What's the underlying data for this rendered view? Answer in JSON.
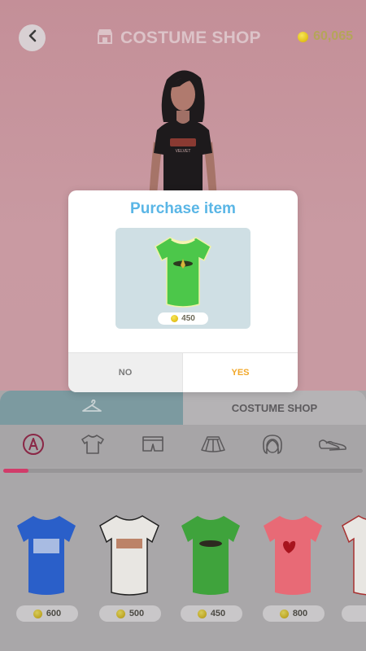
{
  "header": {
    "title": "COSTUME SHOP",
    "coins": "60,065",
    "icons": {
      "back": "chevron-left-icon",
      "store": "store-icon",
      "coin": "coin-icon"
    }
  },
  "tabs": {
    "wardrobe_icon": "hanger-icon",
    "shop_label": "COSTUME SHOP"
  },
  "categories": [
    {
      "name": "all-icon"
    },
    {
      "name": "tshirt-icon"
    },
    {
      "name": "shorts-icon"
    },
    {
      "name": "skirt-icon"
    },
    {
      "name": "hair-icon"
    },
    {
      "name": "shoes-icon"
    }
  ],
  "scroll_progress": 0.07,
  "items": [
    {
      "price": "600",
      "color": "#2a5fc9"
    },
    {
      "price": "500",
      "color": "#e8e6e2"
    },
    {
      "price": "450",
      "color": "#3fa33c"
    },
    {
      "price": "800",
      "color": "#e86a76"
    },
    {
      "price": "",
      "color": "#e8e6e2"
    }
  ],
  "modal": {
    "title": "Purchase item",
    "price": "450",
    "no_label": "NO",
    "yes_label": "YES"
  },
  "colors": {
    "accent_title": "#5ab6e6",
    "yes": "#f2a82a",
    "progress": "#d13c6a"
  }
}
